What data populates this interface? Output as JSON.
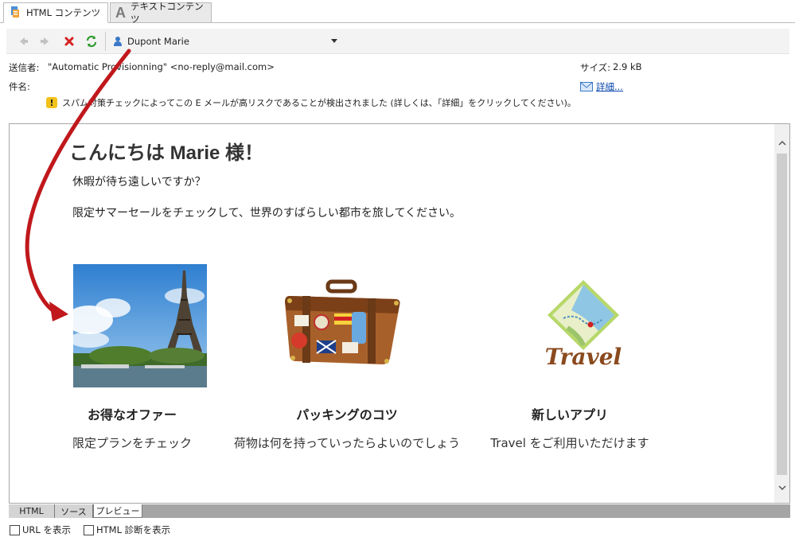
{
  "tabs": [
    {
      "label": "HTML コンテンツ",
      "active": true
    },
    {
      "label": "テキストコンテンツ",
      "active": false
    }
  ],
  "toolbar": {
    "recipient": "Dupont Marie"
  },
  "header": {
    "sender_label": "送信者:",
    "sender_value": "\"Automatic Provisionning\" <no-reply@mail.com>",
    "subject_label": "件名:",
    "size_label": "サイズ:",
    "size_value": "2.9 kB",
    "details_link": "詳細...",
    "spam_warning": "スパム対策チェックによってこの E メールが高リスクであることが検出されました (詳しくは、「詳細」をクリックしてください)。"
  },
  "email": {
    "greeting": "こんにちは Marie 様！",
    "line1": "休暇が待ち遠しいですか？",
    "line2": "限定サマーセールをチェックして、世界のすばらしい都市を旅してください。",
    "cards": [
      {
        "title": "お得なオファー",
        "desc": "限定プランをチェック"
      },
      {
        "title": "パッキングのコツ",
        "desc": "荷物は何を持っていったらよいのでしょう"
      },
      {
        "title": "新しいアプリ",
        "desc": "Travel をご利用いただけます",
        "logo_text": "Travel"
      }
    ]
  },
  "bottom_tabs": [
    {
      "label": "HTML",
      "active": false
    },
    {
      "label": "ソース",
      "active": false
    },
    {
      "label": "プレビュー",
      "active": true
    }
  ],
  "options": {
    "show_url": "URL を表示",
    "show_html_diag": "HTML 診断を表示"
  },
  "colors": {
    "annotation_arrow": "#c0181c",
    "travel_text": "#8a4a1e",
    "link": "#0645ad"
  }
}
